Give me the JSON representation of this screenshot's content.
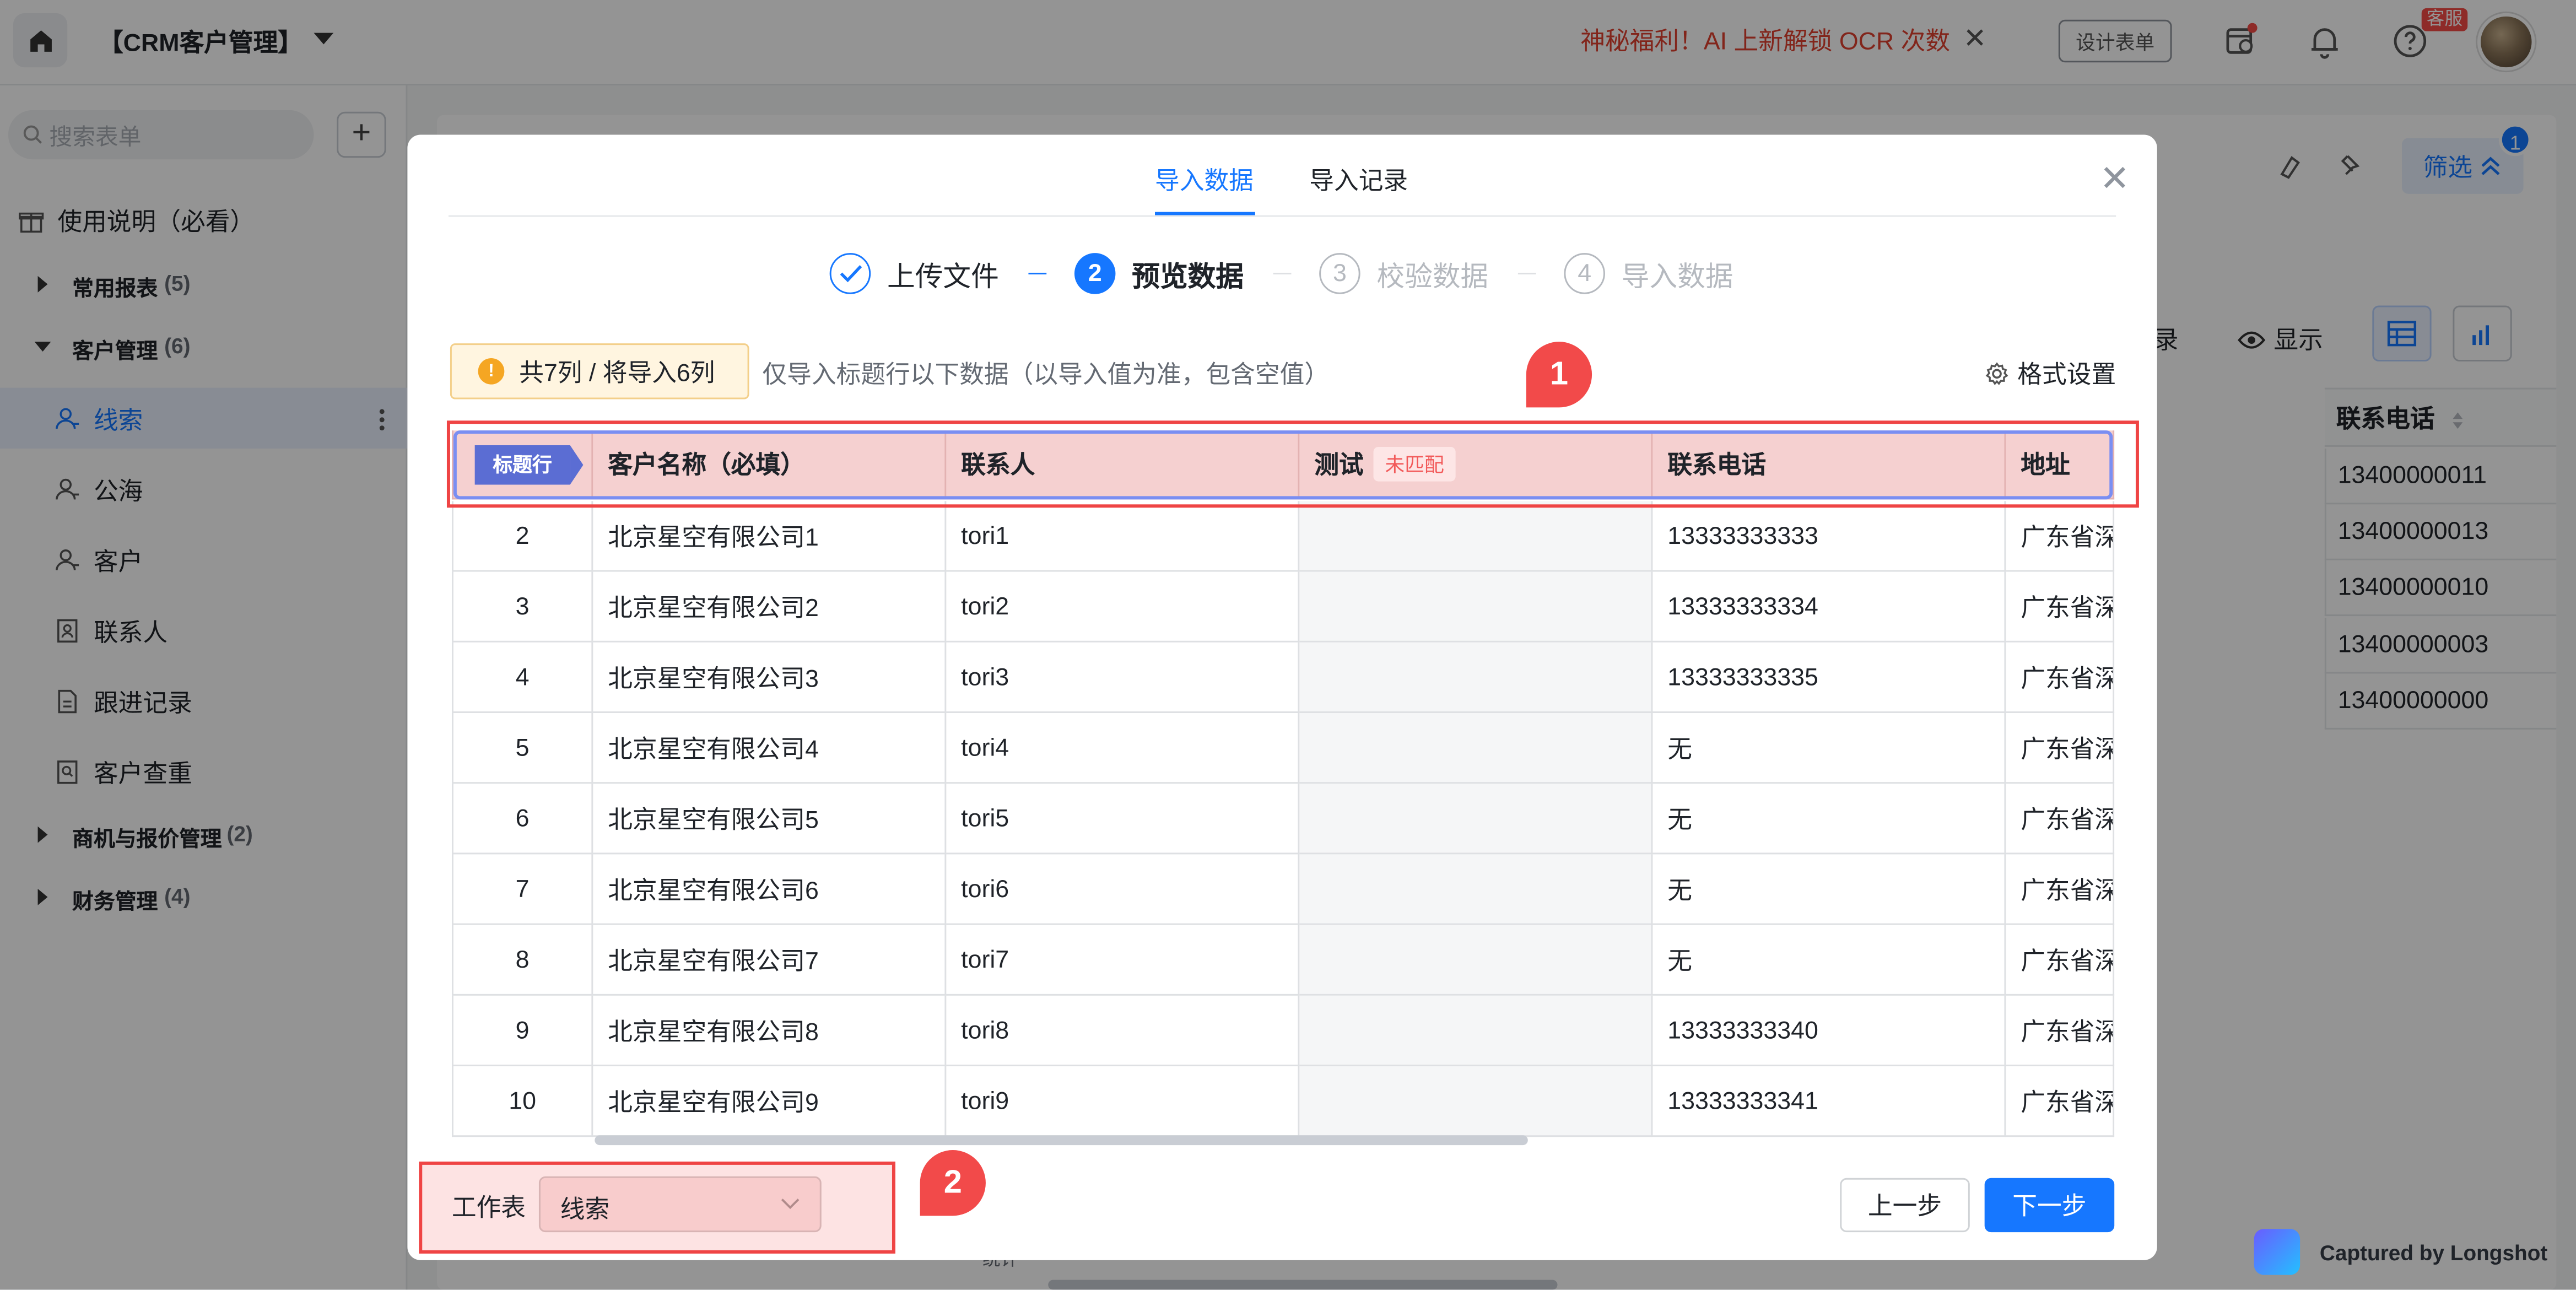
{
  "topbar": {
    "app_title": "【CRM客户管理】",
    "promo": "神秘福利！AI 上新解锁 OCR 次数",
    "design_form": "设计表单",
    "service_badge": "客服"
  },
  "sidebar": {
    "search_placeholder": "搜索表单",
    "usage_guide": "使用说明（必看）",
    "groups": [
      {
        "label": "常用报表",
        "count": "(5)"
      },
      {
        "label": "客户管理",
        "count": "(6)"
      },
      {
        "label": "商机与报价管理",
        "count": "(2)"
      },
      {
        "label": "财务管理",
        "count": "(4)"
      }
    ],
    "items": [
      {
        "label": "线索"
      },
      {
        "label": "公海"
      },
      {
        "label": "客户"
      },
      {
        "label": "联系人"
      },
      {
        "label": "跟进记录"
      },
      {
        "label": "客户查重"
      }
    ]
  },
  "background": {
    "filter_label": "筛选",
    "filter_badge": "1",
    "record_tail": "录",
    "show_label": "显示",
    "column_header": "联系电话",
    "column_values": [
      "13400000011",
      "13400000013",
      "13400000010",
      "13400000003",
      "13400000000"
    ],
    "footer_tail": "统计"
  },
  "modal": {
    "tabs": [
      "导入数据",
      "导入记录"
    ],
    "steps": [
      {
        "num": "",
        "label": "上传文件"
      },
      {
        "num": "2",
        "label": "预览数据"
      },
      {
        "num": "3",
        "label": "校验数据"
      },
      {
        "num": "4",
        "label": "导入数据"
      }
    ],
    "count_badge": "共7列 / 将导入6列",
    "hint": "仅导入标题行以下数据（以导入值为准，包含空值）",
    "format_settings": "格式设置",
    "markers": [
      "1",
      "2"
    ],
    "table": {
      "header_tag": "标题行",
      "headers": [
        "客户名称（必填）",
        "联系人",
        "测试",
        "联系电话",
        "地址"
      ],
      "unmatched_tag": "未匹配",
      "rows": [
        [
          "2",
          "北京星空有限公司1",
          "tori1",
          "",
          "13333333333",
          "广东省深"
        ],
        [
          "3",
          "北京星空有限公司2",
          "tori2",
          "",
          "13333333334",
          "广东省深"
        ],
        [
          "4",
          "北京星空有限公司3",
          "tori3",
          "",
          "13333333335",
          "广东省深"
        ],
        [
          "5",
          "北京星空有限公司4",
          "tori4",
          "",
          "无",
          "广东省深"
        ],
        [
          "6",
          "北京星空有限公司5",
          "tori5",
          "",
          "无",
          "广东省深"
        ],
        [
          "7",
          "北京星空有限公司6",
          "tori6",
          "",
          "无",
          "广东省深"
        ],
        [
          "8",
          "北京星空有限公司7",
          "tori7",
          "",
          "无",
          "广东省深"
        ],
        [
          "9",
          "北京星空有限公司8",
          "tori8",
          "",
          "13333333340",
          "广东省深"
        ],
        [
          "10",
          "北京星空有限公司9",
          "tori9",
          "",
          "13333333341",
          "广东省深"
        ]
      ]
    },
    "worksheet_label": "工作表",
    "worksheet_value": "线索",
    "prev_button": "上一步",
    "next_button": "下一步"
  },
  "watermark": "Captured by Longshot",
  "colors": {
    "primary": "#1677ff",
    "danger": "#ef4444",
    "header_tag": "#5b6dd3",
    "warning_bg": "#fff5e0"
  }
}
